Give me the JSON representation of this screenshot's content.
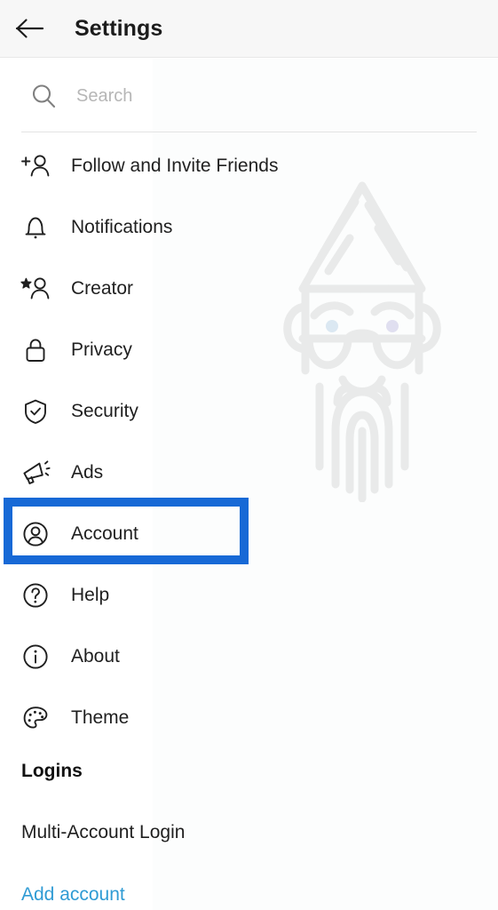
{
  "header": {
    "title": "Settings",
    "back_icon": "arrow-left-icon"
  },
  "search": {
    "placeholder": "Search",
    "value": "",
    "icon": "search-icon"
  },
  "menu": {
    "items": [
      {
        "label": "Follow and Invite Friends",
        "icon": "person-add-icon",
        "selected": false
      },
      {
        "label": "Notifications",
        "icon": "bell-icon",
        "selected": false
      },
      {
        "label": "Creator",
        "icon": "person-star-icon",
        "selected": false
      },
      {
        "label": "Privacy",
        "icon": "lock-icon",
        "selected": false
      },
      {
        "label": "Security",
        "icon": "shield-check-icon",
        "selected": false
      },
      {
        "label": "Ads",
        "icon": "megaphone-icon",
        "selected": false
      },
      {
        "label": "Account",
        "icon": "account-circle-icon",
        "selected": true
      },
      {
        "label": "Help",
        "icon": "question-circle-icon",
        "selected": false
      },
      {
        "label": "About",
        "icon": "info-circle-icon",
        "selected": false
      },
      {
        "label": "Theme",
        "icon": "palette-icon",
        "selected": false
      }
    ]
  },
  "logins": {
    "section_title": "Logins",
    "multi_account_label": "Multi-Account Login",
    "add_account_label": "Add account"
  },
  "watermark": {
    "icon": "gnome-wizard-watermark"
  },
  "colors": {
    "highlight_blue": "#1769d6",
    "link_blue": "#2f9bd4",
    "header_bg": "#f7f7f7",
    "text_primary": "#1f1f1f",
    "placeholder": "#b6b6b6",
    "watermark_gray": "#e9eaea",
    "watermark_eye": "#dbe6f0"
  }
}
